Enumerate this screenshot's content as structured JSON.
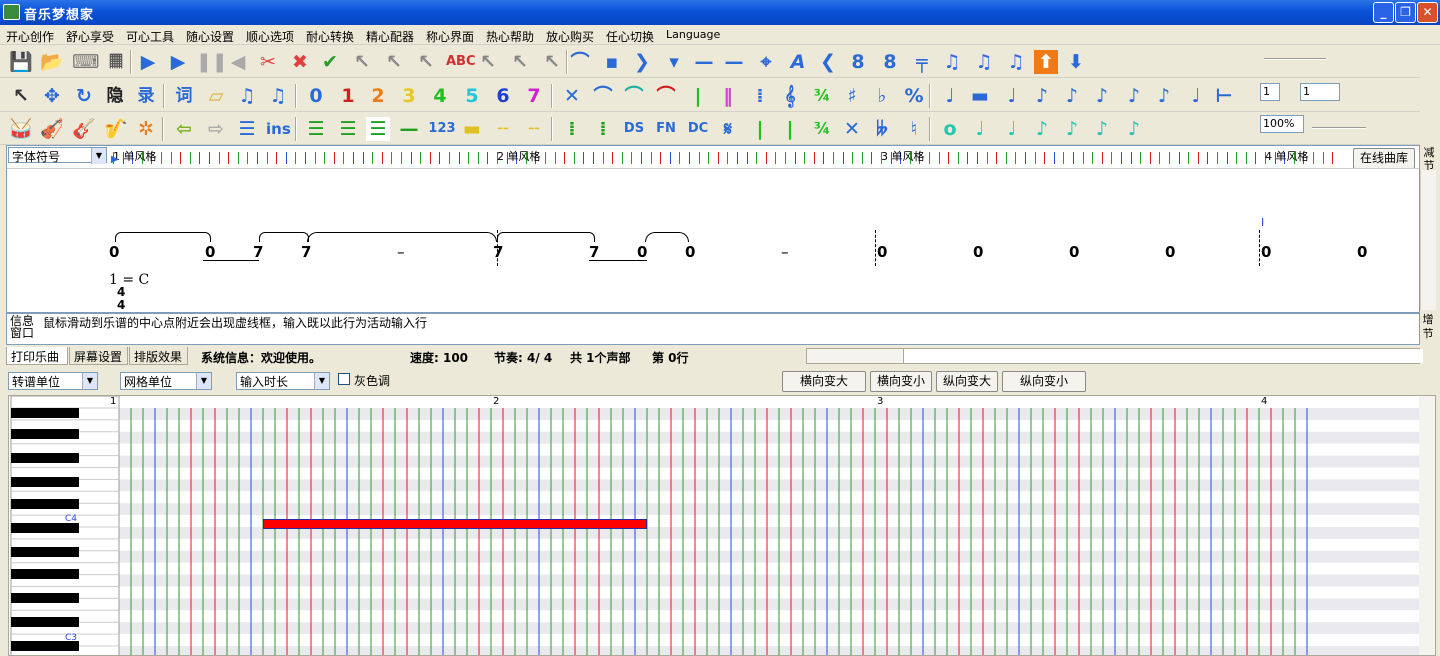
{
  "window": {
    "title": "音乐梦想家",
    "minimize": "_",
    "maximize": "❐",
    "close": "✕"
  },
  "menu": [
    "开心创作",
    "舒心享受",
    "可心工具",
    "随心设置",
    "顺心选项",
    "耐心转换",
    "精心配器",
    "称心界面",
    "热心帮助",
    "放心购买",
    "任心切换",
    "Language"
  ],
  "toolbar": {
    "row2_digits": [
      "0",
      "1",
      "2",
      "3",
      "4",
      "5",
      "6",
      "7"
    ],
    "row3_labels": [
      "ins",
      "123",
      "DS",
      "FN",
      "DC",
      "¾"
    ],
    "row1_inputs": [
      "1",
      "1"
    ],
    "zoom": "100%"
  },
  "score": {
    "font_select": "字体符号",
    "measure_labels": [
      "1 单风格",
      "2 单风格",
      "3 单风格",
      "4 单风格"
    ],
    "online_button": "在线曲库",
    "reduce_button": "减节",
    "add_button": "增节",
    "notes": [
      "0",
      "0",
      "7",
      "7",
      "–",
      "7",
      "7",
      "0",
      "0",
      "–",
      "0",
      "0",
      "0",
      "0",
      "0",
      "0"
    ],
    "key": "1 = C",
    "time_sig": [
      "4",
      "4"
    ],
    "cursor": "I"
  },
  "info": {
    "label": "信息窗口",
    "text": "鼠标滑动到乐谱的中心点附近会出现虚线框，输入既以此行为活动输入行"
  },
  "status": {
    "tabs": [
      "打印乐曲",
      "屏幕设置",
      "排版效果"
    ],
    "system": "系统信息：欢迎使用。",
    "speed": "速度: 100",
    "beat": "节奏: 4/ 4",
    "parts": "共 1个声部",
    "row": "第 0行"
  },
  "piano": {
    "transpose_unit": "转谱单位",
    "grid_unit": "网格单位",
    "input_length": "输入时长",
    "gray_label": "灰色调",
    "buttons": [
      "横向变大",
      "横向变小",
      "纵向变大",
      "纵向变小"
    ],
    "measures": [
      "1",
      "2",
      "3",
      "4"
    ],
    "key_labels": [
      "C4",
      "C3"
    ],
    "note_color": "#ff0000"
  }
}
